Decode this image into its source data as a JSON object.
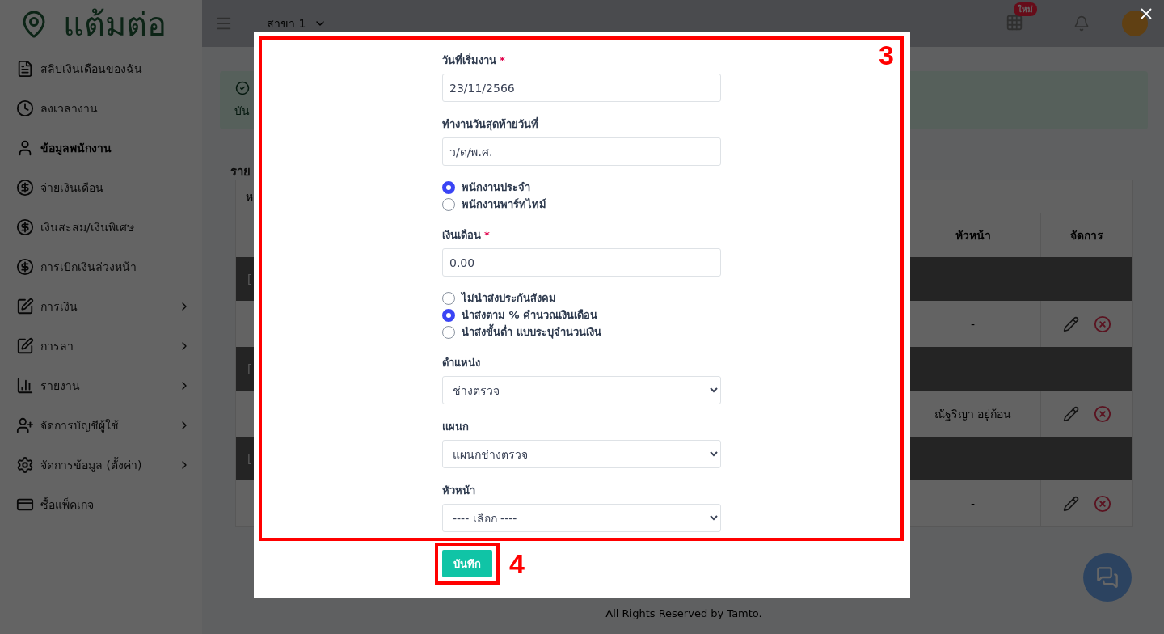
{
  "sidebar": {
    "brand": "แต้มต่อ",
    "items": [
      {
        "label": "สลิปเงินเดือนของฉัน",
        "selected": false,
        "expandable": false
      },
      {
        "label": "ลงเวลางาน",
        "selected": false,
        "expandable": false
      },
      {
        "label": "ข้อมูลพนักงาน",
        "selected": true,
        "expandable": false
      },
      {
        "label": "จ่ายเงินเดือน",
        "selected": false,
        "expandable": false
      },
      {
        "label": "เงินสะสม/เงินพิเศษ",
        "selected": false,
        "expandable": false
      },
      {
        "label": "การเบิกเงินล่วงหน้า",
        "selected": false,
        "expandable": false
      },
      {
        "label": "การเงิน",
        "selected": false,
        "expandable": true
      },
      {
        "label": "การลา",
        "selected": false,
        "expandable": true
      },
      {
        "label": "รายงาน",
        "selected": false,
        "expandable": true
      },
      {
        "label": "จัดการบัญชีผู้ใช้",
        "selected": false,
        "expandable": true
      },
      {
        "label": "จัดการข้อมูล (ตั้งค่า)",
        "selected": false,
        "expandable": true
      },
      {
        "label": "ซื้อแพ็คเกจ",
        "selected": false,
        "expandable": false
      }
    ]
  },
  "header": {
    "branch": "สาขา 1",
    "apps_badge": "ใหม่"
  },
  "main": {
    "alert_text": "บัน",
    "heading": "ราย",
    "table": {
      "caption": "ห",
      "columns": [
        "หัวหน้า",
        "จัดการ"
      ],
      "rows": [
        {
          "kind": "group",
          "label": "["
        },
        {
          "kind": "data",
          "supervisor": "-"
        },
        {
          "kind": "group",
          "label": "["
        },
        {
          "kind": "data",
          "supervisor": "ณัฐริญา อยู่ก้อน"
        },
        {
          "kind": "group",
          "label": "["
        },
        {
          "kind": "data",
          "supervisor": "-"
        }
      ]
    },
    "footer": "All Rights Reserved by Tamto."
  },
  "modal": {
    "fields": [
      {
        "kind": "input",
        "label": "วันที่เริ่มงาน",
        "required_mark": "*",
        "value": "23/11/2566"
      },
      {
        "kind": "input",
        "label": "ทำงานวันสุดท้ายวันที่",
        "placeholder": "ว/ด/พ.ศ."
      },
      {
        "kind": "radio",
        "options": [
          {
            "label": "พนักงานประจำ",
            "selected": true
          },
          {
            "label": "พนักงานพาร์ทไทม์",
            "selected": false
          }
        ]
      },
      {
        "kind": "input",
        "label": "เงินเดือน",
        "required_mark": "*",
        "value": "0.00"
      },
      {
        "kind": "radio",
        "options": [
          {
            "label": "ไม่นำส่งประกันสังคม",
            "selected": false
          },
          {
            "label": "นำส่งตาม % คำนวณเงินเดือน",
            "selected": true
          },
          {
            "label": "นำส่งขั้นต่ำ แบบระบุจำนวนเงิน",
            "selected": false
          }
        ]
      },
      {
        "kind": "select",
        "label": "ตำแหน่ง",
        "value": "ช่างตรวจ"
      },
      {
        "kind": "select",
        "label": "แผนก",
        "value": "แผนกช่างตรวจ"
      },
      {
        "kind": "select",
        "label": "หัวหน้า",
        "value": "---- เลือก ----"
      }
    ],
    "save_button": "บันทึก",
    "annotations": [
      "3",
      "4"
    ]
  }
}
